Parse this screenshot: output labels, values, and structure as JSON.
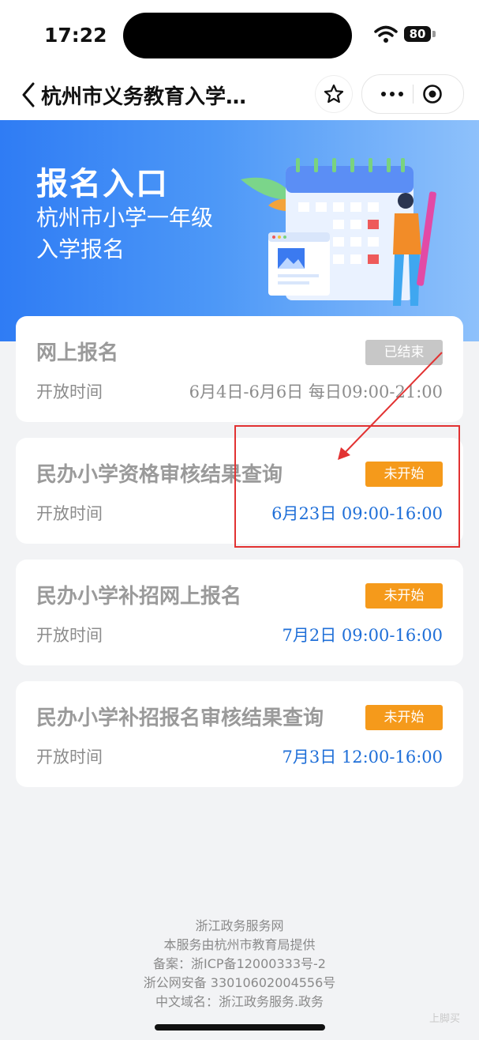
{
  "status_bar": {
    "time": "17:22",
    "battery": "80"
  },
  "nav": {
    "title": "杭州市义务教育入学…"
  },
  "banner": {
    "title": "报名入口",
    "line1": "杭州市小学一年级",
    "line2": "入学报名"
  },
  "cards": [
    {
      "title": "网上报名",
      "badge": "已结束",
      "label": "开放时间",
      "time": "6月4日-6月6日 每日09:00-21:00"
    },
    {
      "title": "民办小学资格审核结果查询",
      "badge": "未开始",
      "label": "开放时间",
      "time": "6月23日 09:00-16:00"
    },
    {
      "title": "民办小学补招网上报名",
      "badge": "未开始",
      "label": "开放时间",
      "time": "7月2日 09:00-16:00"
    },
    {
      "title": "民办小学补招报名审核结果查询",
      "badge": "未开始",
      "label": "开放时间",
      "time": "7月3日 12:00-16:00"
    }
  ],
  "footer": {
    "line1": "浙江政务服务网",
    "line2": "本服务由杭州市教育局提供",
    "line3": "备案：浙ICP备12000333号-2",
    "line4": "浙公网安备 33010602004556号",
    "line5": "中文域名：浙江政务服务.政务"
  },
  "watermark": "上脚买",
  "colors": {
    "accent_blue": "#2f7cf4",
    "badge_orange": "#f59a1b",
    "badge_grey": "#c7c7c7",
    "time_blue": "#1f6fd8",
    "annotation_red": "#e23232"
  },
  "icons": [
    "back-chevron-icon",
    "star-icon",
    "more-dots-icon",
    "target-icon",
    "wifi-icon",
    "battery-icon"
  ]
}
